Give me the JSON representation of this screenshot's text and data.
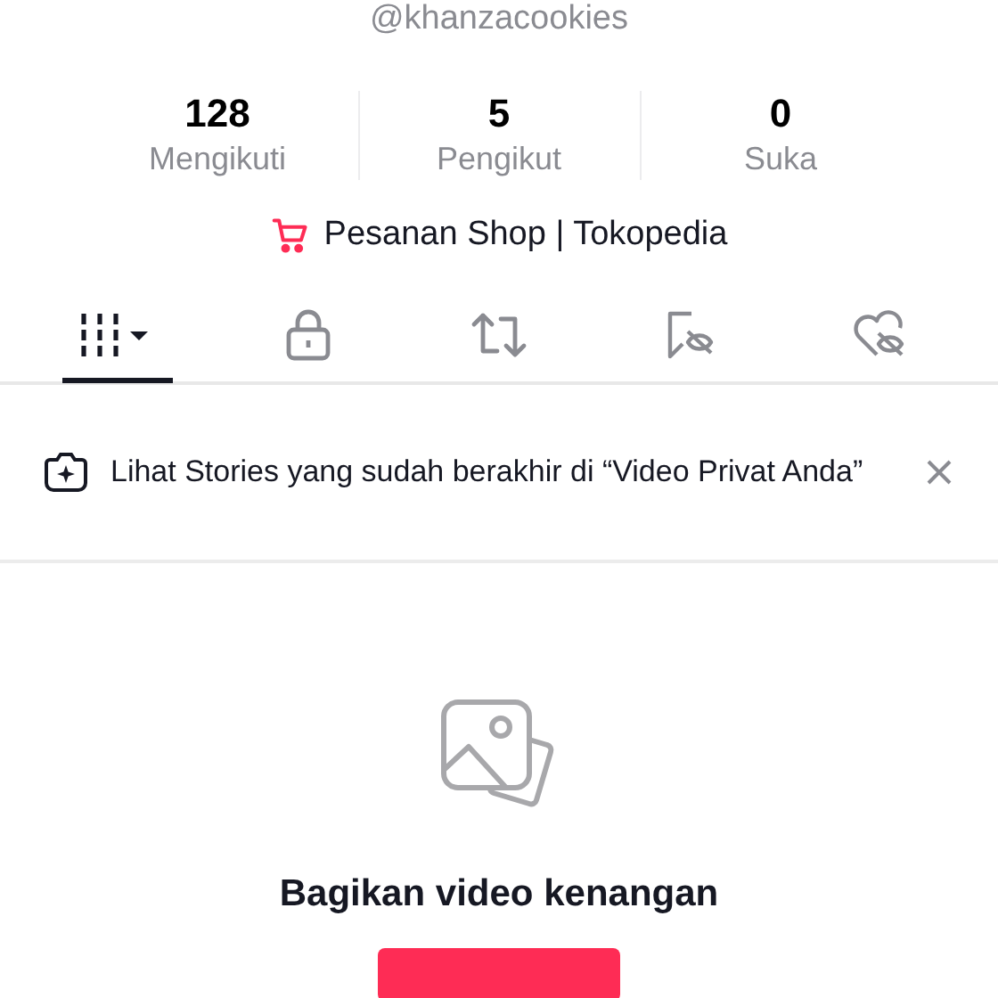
{
  "profile": {
    "username": "@khanzacookies"
  },
  "stats": [
    {
      "value": "128",
      "label": "Mengikuti"
    },
    {
      "value": "5",
      "label": "Pengikut"
    },
    {
      "value": "0",
      "label": "Suka"
    }
  ],
  "shop_link": {
    "label": "Pesanan Shop | Tokopedia"
  },
  "tabs": [
    {
      "kind": "videos",
      "selected": true
    },
    {
      "kind": "private",
      "selected": false
    },
    {
      "kind": "reposts",
      "selected": false
    },
    {
      "kind": "favorites",
      "selected": false
    },
    {
      "kind": "liked",
      "selected": false
    }
  ],
  "banner": {
    "text": "Lihat Stories yang sudah berakhir di “Video Privat Anda”"
  },
  "empty_state": {
    "title": "Bagikan video kenangan"
  }
}
